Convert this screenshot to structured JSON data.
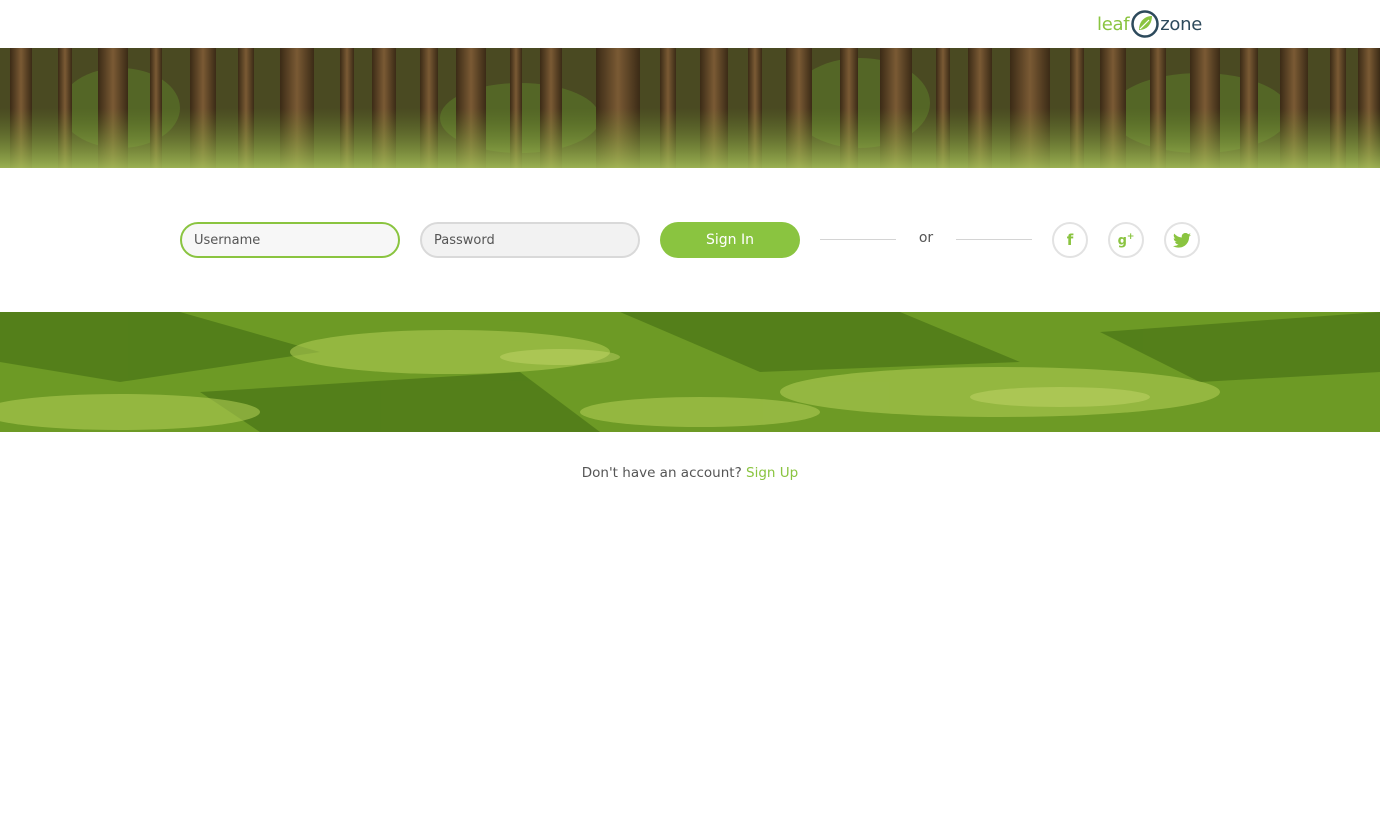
{
  "brand": {
    "logo_text_left": "leaf",
    "logo_text_right": "zone",
    "accent_color": "#8ac440",
    "dark_color": "#2d4a5c"
  },
  "banners": {
    "top": "forest-image",
    "bottom": "grass-image"
  },
  "login": {
    "username_placeholder": "Username",
    "password_placeholder": "Password",
    "signin_label": "Sign In",
    "divider_text": "or",
    "social": [
      {
        "name": "facebook-icon",
        "glyph": "f"
      },
      {
        "name": "google-plus-icon",
        "glyph": "g+"
      },
      {
        "name": "twitter-icon",
        "glyph": "twitter-bird"
      }
    ]
  },
  "signup": {
    "prompt": "Don't have an account?",
    "link_label": "Sign Up"
  }
}
